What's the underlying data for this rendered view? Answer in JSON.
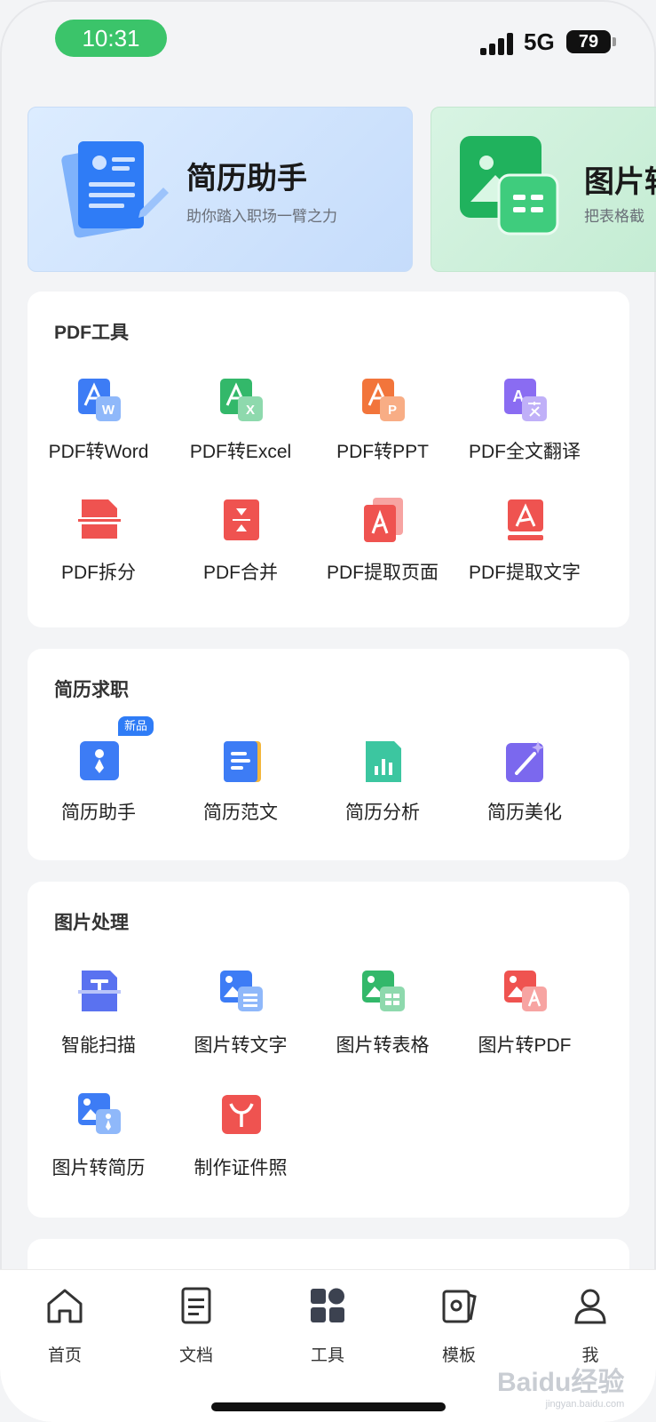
{
  "status_bar": {
    "time": "10:31",
    "network": "5G",
    "battery": "79"
  },
  "banners": [
    {
      "title": "简历助手",
      "subtitle": "助你踏入职场一臂之力"
    },
    {
      "title": "图片转",
      "subtitle": "把表格截"
    }
  ],
  "sections": {
    "pdf": {
      "title": "PDF工具",
      "tools": [
        {
          "label": "PDF转Word",
          "icon": "pdf-to-word-icon"
        },
        {
          "label": "PDF转Excel",
          "icon": "pdf-to-excel-icon"
        },
        {
          "label": "PDF转PPT",
          "icon": "pdf-to-ppt-icon"
        },
        {
          "label": "PDF全文翻译",
          "icon": "pdf-translate-icon"
        },
        {
          "label": "PDF拆分",
          "icon": "pdf-split-icon"
        },
        {
          "label": "PDF合并",
          "icon": "pdf-merge-icon"
        },
        {
          "label": "PDF提取页面",
          "icon": "pdf-extract-pages-icon"
        },
        {
          "label": "PDF提取文字",
          "icon": "pdf-extract-text-icon"
        }
      ]
    },
    "resume": {
      "title": "简历求职",
      "badge": "新品",
      "tools": [
        {
          "label": "简历助手",
          "icon": "resume-assistant-icon"
        },
        {
          "label": "简历范文",
          "icon": "resume-sample-icon"
        },
        {
          "label": "简历分析",
          "icon": "resume-analysis-icon"
        },
        {
          "label": "简历美化",
          "icon": "resume-beautify-icon"
        }
      ]
    },
    "image": {
      "title": "图片处理",
      "tools": [
        {
          "label": "智能扫描",
          "icon": "smart-scan-icon"
        },
        {
          "label": "图片转文字",
          "icon": "image-to-text-icon"
        },
        {
          "label": "图片转表格",
          "icon": "image-to-table-icon"
        },
        {
          "label": "图片转PDF",
          "icon": "image-to-pdf-icon"
        },
        {
          "label": "图片转简历",
          "icon": "image-to-resume-icon"
        },
        {
          "label": "制作证件照",
          "icon": "id-photo-icon"
        }
      ]
    }
  },
  "bottom_nav": [
    {
      "label": "首页",
      "icon": "home-icon"
    },
    {
      "label": "文档",
      "icon": "document-icon"
    },
    {
      "label": "工具",
      "icon": "tools-icon",
      "active": true
    },
    {
      "label": "模板",
      "icon": "template-icon"
    },
    {
      "label": "我",
      "icon": "profile-icon"
    }
  ],
  "watermark": {
    "text": "Baidu经验",
    "sub": "jingyan.baidu.com"
  },
  "colors": {
    "blue": "#3d7cf5",
    "green": "#33b86a",
    "orange": "#f2753b",
    "purple": "#8a6cf2",
    "red": "#ef5350",
    "teal": "#3cc6a0",
    "accent_pill": "#3bc46a"
  }
}
